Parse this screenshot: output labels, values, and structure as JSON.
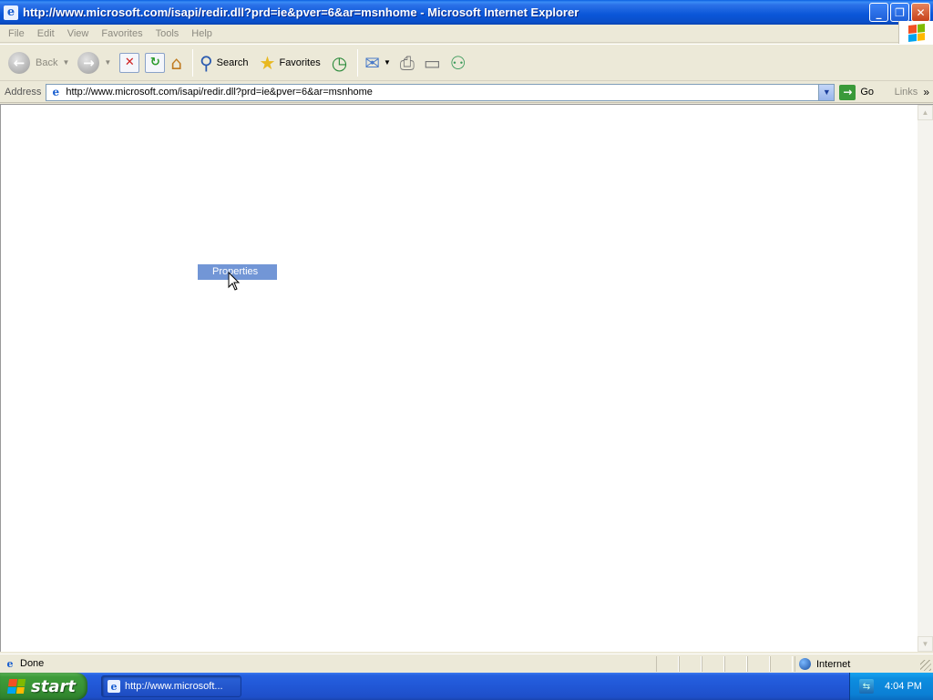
{
  "window": {
    "title": "http://www.microsoft.com/isapi/redir.dll?prd=ie&pver=6&ar=msnhome - Microsoft Internet Explorer",
    "controls": {
      "minimize": "_",
      "restore": "❐",
      "close": "✕"
    }
  },
  "menu": {
    "items": [
      "File",
      "Edit",
      "View",
      "Favorites",
      "Tools",
      "Help"
    ]
  },
  "toolbar": {
    "back_label": "Back",
    "search_label": "Search",
    "favorites_label": "Favorites"
  },
  "address": {
    "label": "Address",
    "url": "http://www.microsoft.com/isapi/redir.dll?prd=ie&pver=6&ar=msnhome",
    "go_label": "Go",
    "links_label": "Links"
  },
  "context_menu": {
    "item_label": "Properties"
  },
  "status": {
    "text": "Done",
    "zone": "Internet"
  },
  "taskbar": {
    "start_label": "start",
    "task_label": "http://www.microsoft...",
    "clock": "4:04 PM"
  },
  "icons": {
    "app": "ie-icon",
    "back": "back-arrow-icon",
    "forward": "forward-arrow-icon",
    "stop": "stop-icon",
    "refresh": "refresh-icon",
    "home": "home-icon",
    "search": "search-icon",
    "favorites": "star-icon",
    "history": "history-icon",
    "mail": "mail-icon",
    "print": "printer-icon",
    "edit": "edit-icon",
    "messenger": "messenger-icon"
  },
  "colors": {
    "titlebar": "#0a56d8",
    "selection": "#7296d6",
    "start_button": "#379134",
    "tray": "#0b7fd4"
  }
}
